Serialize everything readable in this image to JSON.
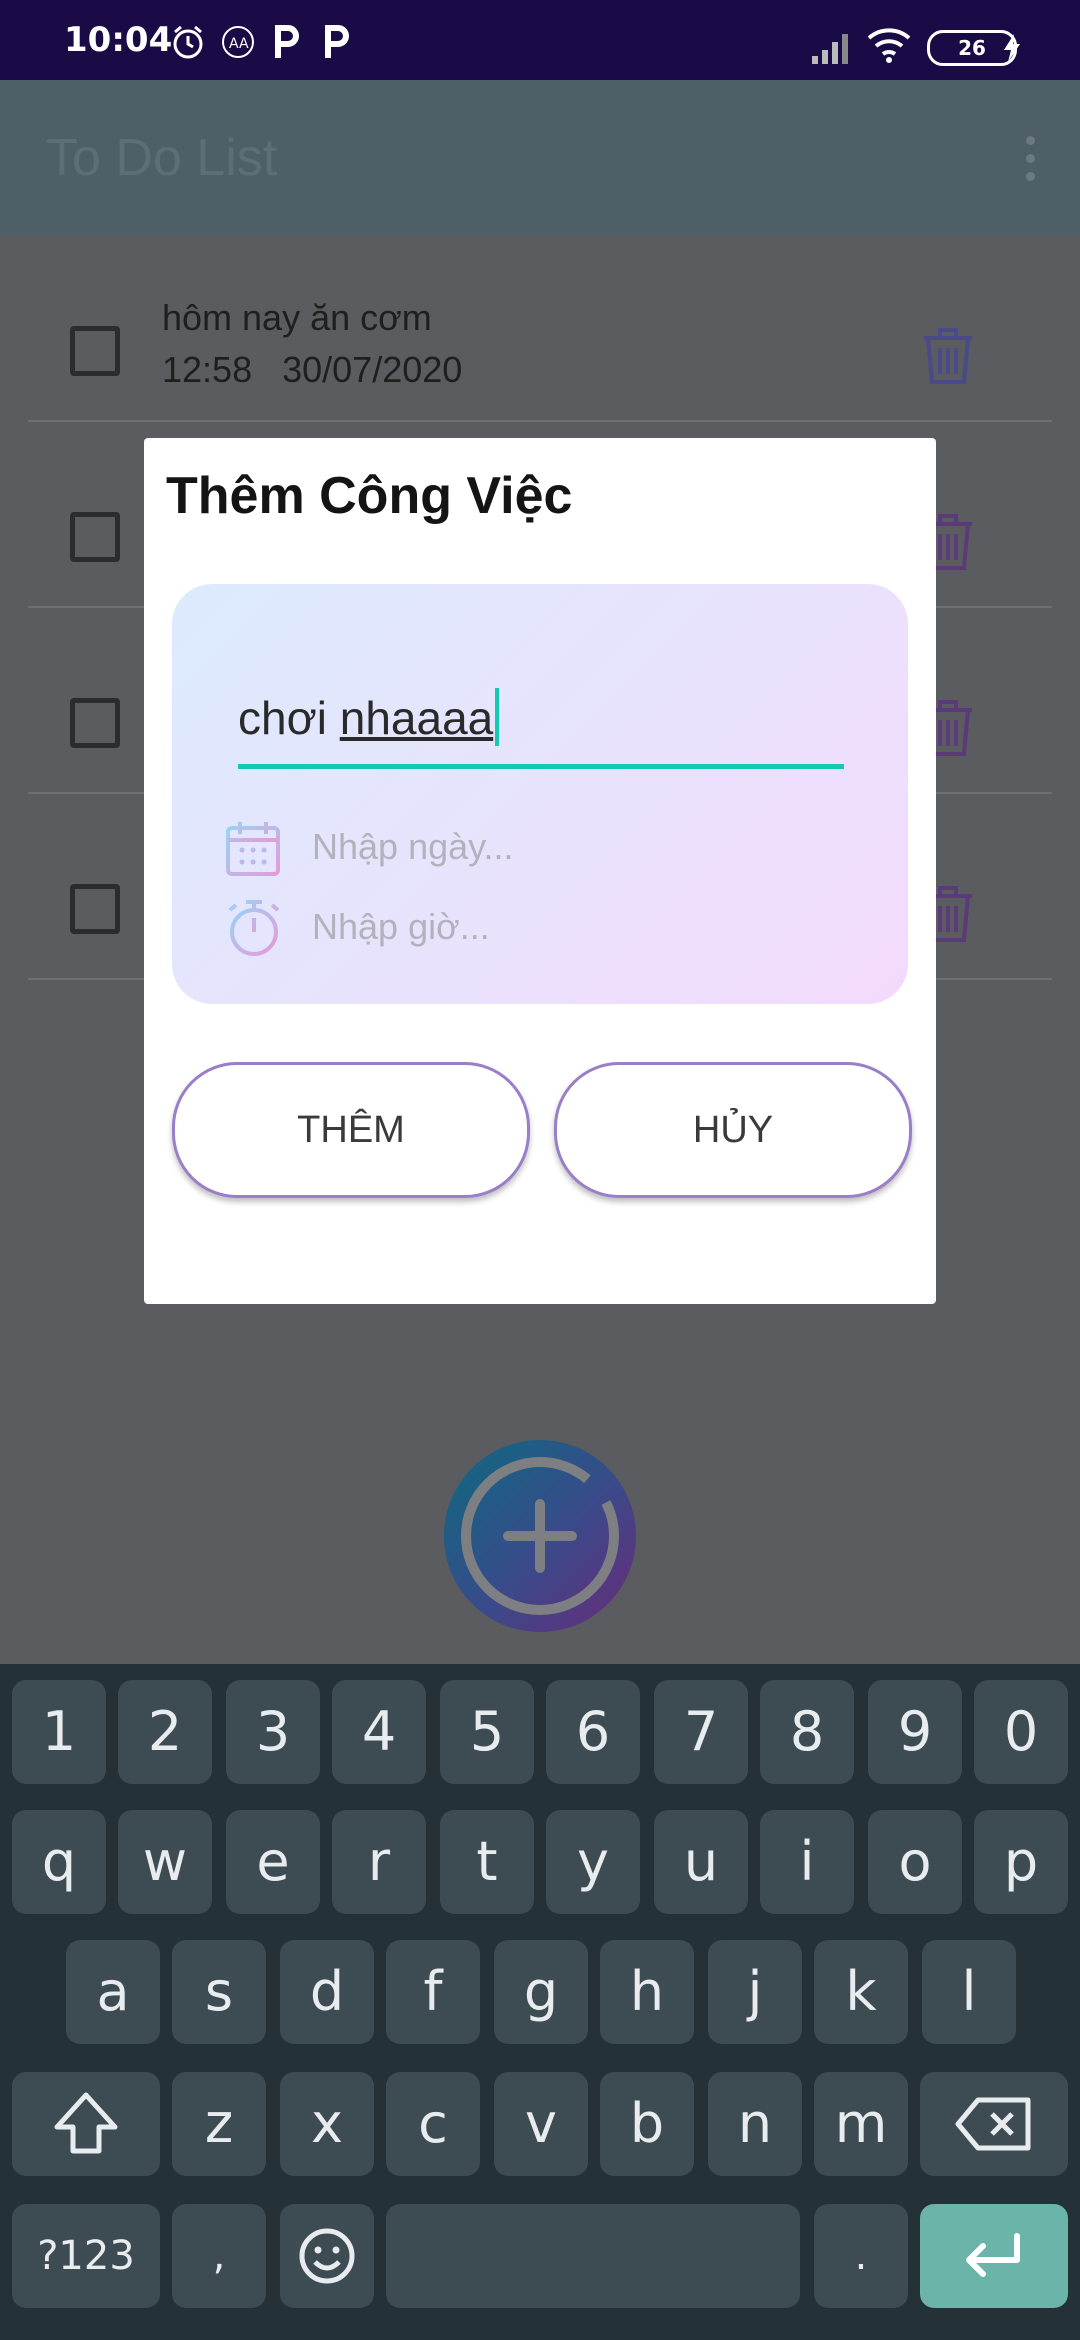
{
  "status_bar": {
    "time": "10:04",
    "battery": "26",
    "icons": [
      "alarm-icon",
      "app-icon",
      "parking-icon",
      "parking-icon",
      "signal-icon",
      "wifi-icon",
      "charging-icon"
    ]
  },
  "app_bar": {
    "title": "To Do List"
  },
  "tasks": [
    {
      "title": "hôm nay ăn cơm",
      "time": "12:58",
      "date": "30/07/2020"
    },
    {
      "title": "",
      "time": "",
      "date": ""
    },
    {
      "title": "",
      "time": "",
      "date": ""
    },
    {
      "title": "",
      "time": "",
      "date": ""
    }
  ],
  "dialog": {
    "title": "Thêm Công Việc",
    "task_input": {
      "value_plain": "chơi ",
      "value_underlined": "nhaaaa"
    },
    "date_placeholder": "Nhập ngày...",
    "time_placeholder": "Nhập giờ...",
    "add_button": "THÊM",
    "cancel_button": "HỦY"
  },
  "keyboard": {
    "row1": [
      "1",
      "2",
      "3",
      "4",
      "5",
      "6",
      "7",
      "8",
      "9",
      "0"
    ],
    "row2": [
      "q",
      "w",
      "e",
      "r",
      "t",
      "y",
      "u",
      "i",
      "o",
      "p"
    ],
    "row3": [
      "a",
      "s",
      "d",
      "f",
      "g",
      "h",
      "j",
      "k",
      "l"
    ],
    "row4": [
      "z",
      "x",
      "c",
      "v",
      "b",
      "n",
      "m"
    ],
    "symbols_key": "?123",
    "comma_key": ",",
    "period_key": "."
  },
  "colors": {
    "accent": "#13c9b1",
    "status_bar": "#1a0a45",
    "enter_key": "#6ab4aa",
    "button_border": "#9a7ec8"
  }
}
